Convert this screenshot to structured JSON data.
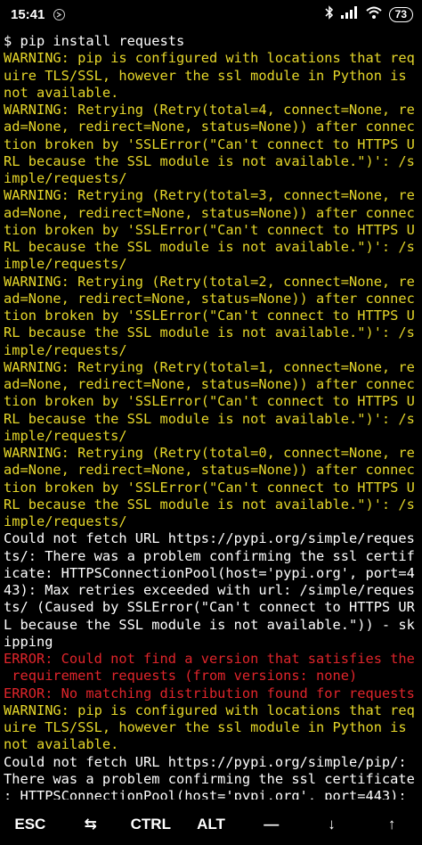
{
  "status_bar": {
    "time": "15:41",
    "battery": "73"
  },
  "terminal": {
    "lines": [
      {
        "text": "$ pip install requests",
        "color": "white"
      },
      {
        "text": "WARNING: pip is configured with locations that req",
        "color": "yellow"
      },
      {
        "text": "uire TLS/SSL, however the ssl module in Python is",
        "color": "yellow"
      },
      {
        "text": "not available.",
        "color": "yellow"
      },
      {
        "text": "WARNING: Retrying (Retry(total=4, connect=None, re",
        "color": "yellow"
      },
      {
        "text": "ad=None, redirect=None, status=None)) after connec",
        "color": "yellow"
      },
      {
        "text": "tion broken by 'SSLError(\"Can't connect to HTTPS U",
        "color": "yellow"
      },
      {
        "text": "RL because the SSL module is not available.\")': /s",
        "color": "yellow"
      },
      {
        "text": "imple/requests/",
        "color": "yellow"
      },
      {
        "text": "WARNING: Retrying (Retry(total=3, connect=None, re",
        "color": "yellow"
      },
      {
        "text": "ad=None, redirect=None, status=None)) after connec",
        "color": "yellow"
      },
      {
        "text": "tion broken by 'SSLError(\"Can't connect to HTTPS U",
        "color": "yellow"
      },
      {
        "text": "RL because the SSL module is not available.\")': /s",
        "color": "yellow"
      },
      {
        "text": "imple/requests/",
        "color": "yellow"
      },
      {
        "text": "WARNING: Retrying (Retry(total=2, connect=None, re",
        "color": "yellow"
      },
      {
        "text": "ad=None, redirect=None, status=None)) after connec",
        "color": "yellow"
      },
      {
        "text": "tion broken by 'SSLError(\"Can't connect to HTTPS U",
        "color": "yellow"
      },
      {
        "text": "RL because the SSL module is not available.\")': /s",
        "color": "yellow"
      },
      {
        "text": "imple/requests/",
        "color": "yellow"
      },
      {
        "text": "WARNING: Retrying (Retry(total=1, connect=None, re",
        "color": "yellow"
      },
      {
        "text": "ad=None, redirect=None, status=None)) after connec",
        "color": "yellow"
      },
      {
        "text": "tion broken by 'SSLError(\"Can't connect to HTTPS U",
        "color": "yellow"
      },
      {
        "text": "RL because the SSL module is not available.\")': /s",
        "color": "yellow"
      },
      {
        "text": "imple/requests/",
        "color": "yellow"
      },
      {
        "text": "WARNING: Retrying (Retry(total=0, connect=None, re",
        "color": "yellow"
      },
      {
        "text": "ad=None, redirect=None, status=None)) after connec",
        "color": "yellow"
      },
      {
        "text": "tion broken by 'SSLError(\"Can't connect to HTTPS U",
        "color": "yellow"
      },
      {
        "text": "RL because the SSL module is not available.\")': /s",
        "color": "yellow"
      },
      {
        "text": "imple/requests/",
        "color": "yellow"
      },
      {
        "text": "Could not fetch URL https://pypi.org/simple/reques",
        "color": "white"
      },
      {
        "text": "ts/: There was a problem confirming the ssl certif",
        "color": "white"
      },
      {
        "text": "icate: HTTPSConnectionPool(host='pypi.org', port=4",
        "color": "white"
      },
      {
        "text": "43): Max retries exceeded with url: /simple/reques",
        "color": "white"
      },
      {
        "text": "ts/ (Caused by SSLError(\"Can't connect to HTTPS UR",
        "color": "white"
      },
      {
        "text": "L because the SSL module is not available.\")) - sk",
        "color": "white"
      },
      {
        "text": "ipping",
        "color": "white"
      },
      {
        "text": "ERROR: Could not find a version that satisfies the",
        "color": "red"
      },
      {
        "text": " requirement requests (from versions: none)",
        "color": "red"
      },
      {
        "text": "ERROR: No matching distribution found for requests",
        "color": "red"
      },
      {
        "text": "WARNING: pip is configured with locations that req",
        "color": "yellow"
      },
      {
        "text": "uire TLS/SSL, however the ssl module in Python is",
        "color": "yellow"
      },
      {
        "text": "not available.",
        "color": "yellow"
      },
      {
        "text": "Could not fetch URL https://pypi.org/simple/pip/:",
        "color": "white"
      },
      {
        "text": "There was a problem confirming the ssl certificate",
        "color": "white"
      },
      {
        "text": ": HTTPSConnectionPool(host='pypi.org', port=443):",
        "color": "white"
      }
    ]
  },
  "extra_keys": [
    {
      "label": "ESC",
      "name": "esc-key"
    },
    {
      "label": "⇆",
      "name": "tab-key"
    },
    {
      "label": "CTRL",
      "name": "ctrl-key"
    },
    {
      "label": "ALT",
      "name": "alt-key"
    },
    {
      "label": "—",
      "name": "dash-key"
    },
    {
      "label": "↓",
      "name": "arrow-down-key"
    },
    {
      "label": "↑",
      "name": "arrow-up-key"
    }
  ],
  "colors": {
    "white": "#ffffff",
    "yellow": "#e6d72a",
    "red": "#e0252b"
  }
}
